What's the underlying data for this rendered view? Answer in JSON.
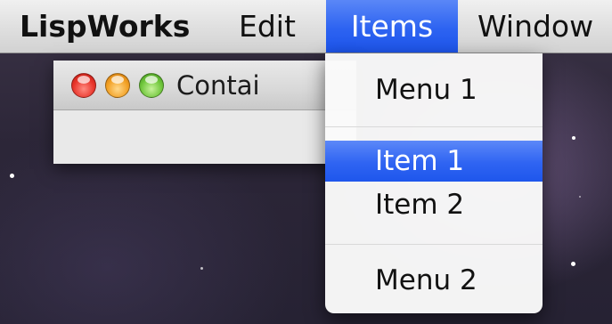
{
  "menubar": {
    "app_name": "LispWorks",
    "menus": [
      "Edit",
      "Items",
      "Window"
    ],
    "active_menu": "Items"
  },
  "window": {
    "title_visible": "Contai"
  },
  "dropdown": {
    "items": [
      {
        "label": "Menu 1",
        "selected": false
      },
      {
        "label": "Item 1",
        "selected": true
      },
      {
        "label": "Item 2",
        "selected": false
      },
      {
        "label": "Menu 2",
        "selected": false
      }
    ]
  },
  "colors": {
    "highlight": "#2d63f1",
    "close_button": "#e8352b",
    "minimize_button": "#f2a024",
    "zoom_button": "#6fc63b"
  }
}
